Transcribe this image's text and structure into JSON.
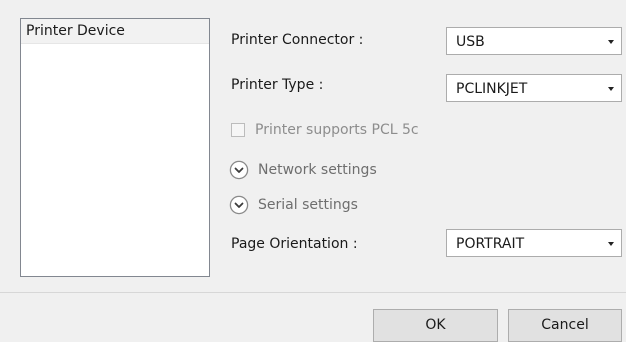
{
  "device_list": {
    "items": [
      "Printer Device"
    ]
  },
  "connector": {
    "label": "Printer Connector  :",
    "value": "USB"
  },
  "type": {
    "label": "Printer Type :",
    "value": "PCLINKJET"
  },
  "pcl_checkbox": {
    "label": "Printer supports PCL 5c",
    "checked": false
  },
  "network": {
    "label": "Network settings"
  },
  "serial": {
    "label": "Serial settings"
  },
  "orientation": {
    "label": "Page Orientation :",
    "value": "PORTRAIT"
  },
  "buttons": {
    "ok": "OK",
    "cancel": "Cancel"
  },
  "icons": {
    "dropdown": "chevron-down-icon",
    "expander": "chevron-circle-down-icon"
  }
}
